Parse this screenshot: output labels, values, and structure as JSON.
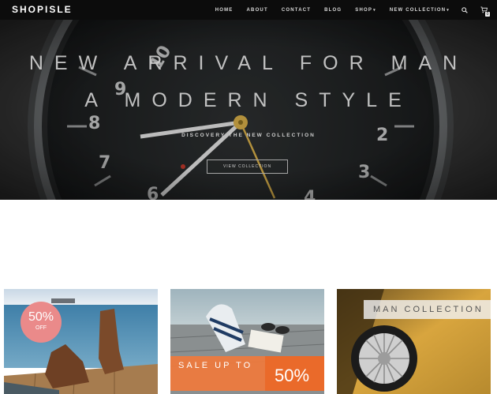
{
  "brand": "SHOPISLE",
  "nav": {
    "items": [
      "HOME",
      "ABOUT",
      "CONTACT",
      "BLOG",
      "SHOP",
      "NEW COLLECTION"
    ],
    "dropdown_caret": "▾",
    "search_icon": "search-icon",
    "cart_icon": "cart-icon",
    "cart_count": "0"
  },
  "hero": {
    "title_line1": "NEW ARRIVAL FOR MAN",
    "title_line2": "A MODERN STYLE",
    "subtitle": "DISCOVERY THE NEW COLLECTION",
    "button": "VIEW COLLECTION",
    "watch_numerals": [
      "10",
      "8",
      "9",
      "7",
      "6",
      "2",
      "3",
      "4"
    ]
  },
  "banners": {
    "b1": {
      "pct": "50%",
      "off": "OFF"
    },
    "b2": {
      "sale": "SALE UP TO",
      "pct": "50%"
    },
    "b3": {
      "label": "MAN COLLECTION"
    }
  },
  "colors": {
    "navbar": "#0c0c0c",
    "badge": "#ea8a8a",
    "sale_orange": "#f07a3c"
  }
}
